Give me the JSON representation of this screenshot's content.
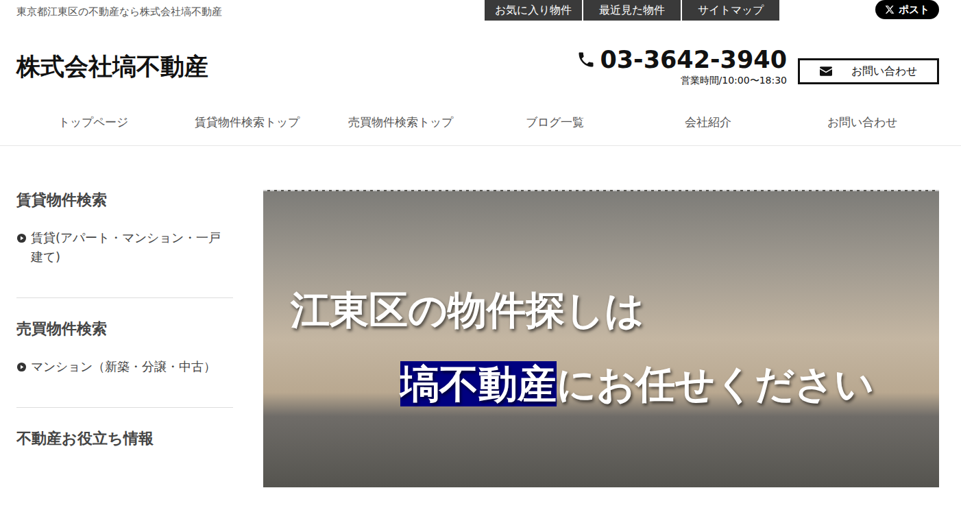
{
  "topbar": {
    "tagline": "東京都江東区の不動産なら株式会社塙不動産",
    "links": [
      "お気に入り物件",
      "最近見た物件",
      "サイトマップ"
    ],
    "share": "ポスト"
  },
  "header": {
    "company": "株式会社塙不動産",
    "phone": "03-3642-3940",
    "hours": "営業時間/10:00〜18:30",
    "contact": "お問い合わせ"
  },
  "nav": [
    "トップページ",
    "賃貸物件検索トップ",
    "売買物件検索トップ",
    "ブログ一覧",
    "会社紹介",
    "お問い合わせ"
  ],
  "sidebar": [
    {
      "title": "賃貸物件検索",
      "items": [
        "賃貸(アパート・マンション・一戸建て)"
      ]
    },
    {
      "title": "売買物件検索",
      "items": [
        "マンション（新築・分譲・中古）"
      ]
    },
    {
      "title": "不動産お役立ち情報",
      "items": []
    }
  ],
  "banner": {
    "line1": "江東区の物件探しは",
    "highlight": "塙不動産",
    "rest": "にお任せください"
  }
}
